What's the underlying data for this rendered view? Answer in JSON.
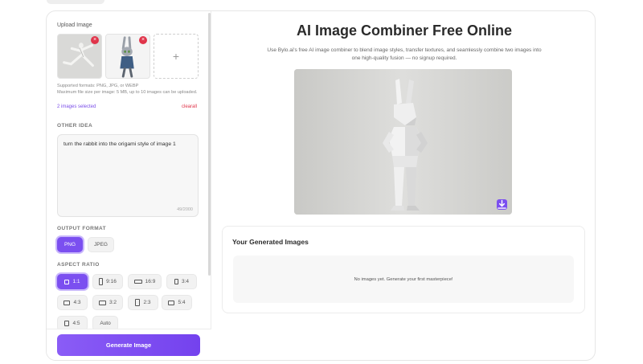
{
  "upload": {
    "label": "Upload Image",
    "thumbs": [
      {
        "name": "dancer-image"
      },
      {
        "name": "rabbit-image"
      }
    ],
    "add_label": "+",
    "remove_glyph": "×",
    "formats_note": "Supported formats: PNG, JPG, or WEBP",
    "size_note": "Maximum file size per image: 5 MB, up to 10 images can be uploaded.",
    "selected_count": "2 images selected",
    "clear_label": "clearall"
  },
  "idea": {
    "label": "OTHER IDEA",
    "text": "turn the rabbit into the origami style of image 1",
    "counter": "49/2000"
  },
  "output_format": {
    "label": "OUTPUT FORMAT",
    "options": [
      "PNG",
      "JPEG"
    ],
    "selected": "PNG"
  },
  "aspect_ratio": {
    "label": "ASPECT RATIO",
    "options": [
      "1:1",
      "9:16",
      "16:9",
      "3:4",
      "4:3",
      "3:2",
      "2:3",
      "5:4",
      "4:5",
      "Auto"
    ],
    "selected": "1:1"
  },
  "generate_label": "Generate Image",
  "main": {
    "title": "AI Image Combiner Free Online",
    "subtitle": "Use Bylo.ai's free AI image combiner to blend image styles, transfer textures, and seamlessly combine two images into one high-quality fusion — no signup required.",
    "download_icon": "download-icon"
  },
  "gallery": {
    "title": "Your Generated Images",
    "empty_text": "No images yet. Generate your first masterpiece!"
  },
  "colors": {
    "accent": "#7b4ff0",
    "danger": "#e0344a"
  }
}
